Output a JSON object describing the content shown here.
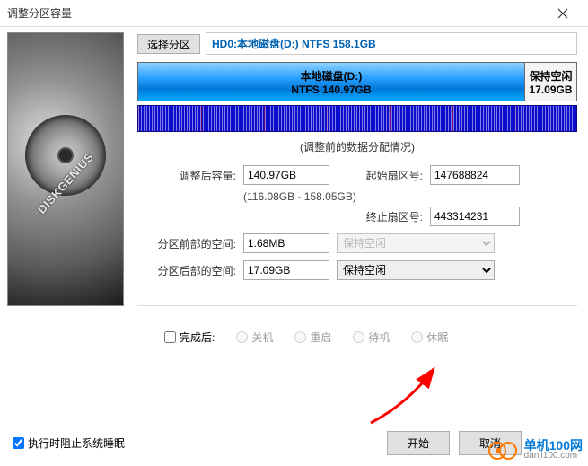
{
  "titlebar": {
    "title": "调整分区容量"
  },
  "sidebar": {
    "brand": "DISKGENIUS"
  },
  "partition_select_btn": "选择分区",
  "partition_label": "HD0:本地磁盘(D:) NTFS 158.1GB",
  "bar": {
    "name": "本地磁盘(D:)",
    "fs": "NTFS 140.97GB",
    "free_label": "保持空闲",
    "free_size": "17.09GB"
  },
  "usage_caption": "(调整前的数据分配情况)",
  "fields": {
    "size_after_label": "调整后容量:",
    "size_after_value": "140.97GB",
    "start_sector_label": "起始扇区号:",
    "start_sector_value": "147688824",
    "range_note": "(116.08GB - 158.05GB)",
    "end_sector_label": "终止扇区号:",
    "end_sector_value": "443314231",
    "space_before_label": "分区前部的空间:",
    "space_before_value": "1.68MB",
    "space_before_option": "保持空闲",
    "space_after_label": "分区后部的空间:",
    "space_after_value": "17.09GB",
    "space_after_option": "保持空闲"
  },
  "after": {
    "checkbox_label": "完成后:",
    "radios": [
      "关机",
      "重启",
      "待机",
      "休眠"
    ]
  },
  "footer": {
    "prevent_sleep": "执行时阻止系统睡眠",
    "start": "开始",
    "cancel": "取消"
  },
  "watermark": {
    "name": "单机100网",
    "url": "danji100.com"
  }
}
